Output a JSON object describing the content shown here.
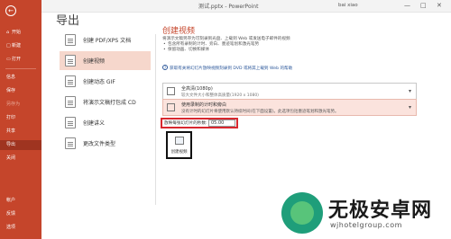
{
  "window": {
    "doc_title": "测试.pptx  -  PowerPoint",
    "user": "bai xiao",
    "minimize": "—",
    "maximize": "□",
    "close": "✕"
  },
  "sidebar": {
    "back_icon": "back-arrow-icon",
    "items": [
      {
        "label": "开始",
        "icon": "⌂"
      },
      {
        "label": "新建",
        "icon": "□"
      },
      {
        "label": "打开",
        "icon": "▭"
      },
      {
        "label": "信息",
        "icon": ""
      },
      {
        "label": "保存",
        "icon": ""
      },
      {
        "label": "另存为",
        "icon": ""
      },
      {
        "label": "打印",
        "icon": ""
      },
      {
        "label": "共享",
        "icon": ""
      },
      {
        "label": "导出",
        "icon": ""
      },
      {
        "label": "关闭",
        "icon": ""
      },
      {
        "label": "帐户",
        "icon": ""
      },
      {
        "label": "反馈",
        "icon": ""
      },
      {
        "label": "选项",
        "icon": ""
      }
    ]
  },
  "page_title": "导出",
  "export_options": [
    {
      "label": "创建 PDF/XPS 文档"
    },
    {
      "label": "创建视频"
    },
    {
      "label": "创建动态 GIF"
    },
    {
      "label": "将演示文稿打包成 CD"
    },
    {
      "label": "创建讲义"
    },
    {
      "label": "更改文件类型"
    }
  ],
  "detail": {
    "title": "创建视频",
    "intro": "将演示文稿另存为可刻录到光盘、上载到 Web 或发送电子邮件的视频",
    "bullets": [
      "包含所有录制的计时、旁白、墨迹笔划和激光笔势",
      "保留动画、切换和媒体"
    ],
    "link": "获取有关将幻灯片放映视频刻录到 DVD 或将其上载到 Web 的帮助",
    "quality": {
      "title": "全高清(1080p)",
      "subtitle": "较大文件大小和整体高质量(1920 x 1080)"
    },
    "timings": {
      "title": "使用录制的计时和旁白",
      "subtitle": "没有计时的幻灯片将使用默认持续时间(在下面设置)。此选项包括墨迹笔划和激光笔势。"
    },
    "seconds_label": "放映每张幻灯片的秒数:",
    "seconds_value": "05.00",
    "create_button_label": "创建视频"
  },
  "watermark": {
    "title": "无极安卓网",
    "url": "wjhotelgroup.com"
  }
}
